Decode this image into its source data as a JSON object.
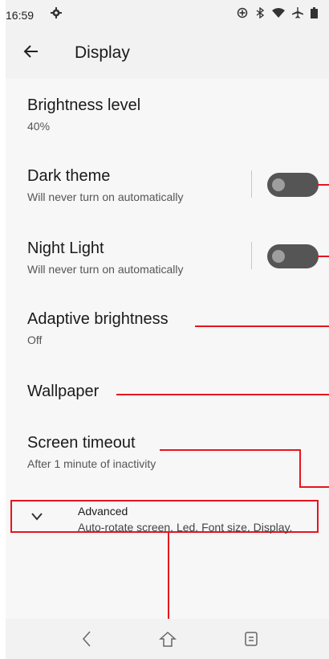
{
  "status_bar": {
    "time": "16:59",
    "icons": [
      "settings-gear-icon",
      "data-saver-icon",
      "bluetooth-icon",
      "wifi-icon",
      "airplane-mode-icon",
      "battery-icon"
    ]
  },
  "app_bar": {
    "title": "Display",
    "back_icon": "back-arrow-icon"
  },
  "settings": [
    {
      "title": "Brightness level",
      "subtitle": "40%"
    },
    {
      "title": "Dark theme",
      "subtitle": "Will never turn on automatically",
      "toggle": false
    },
    {
      "title": "Night Light",
      "subtitle": "Will never turn on automatically",
      "toggle": false
    },
    {
      "title": "Adaptive brightness",
      "subtitle": "Off"
    },
    {
      "title": "Wallpaper"
    },
    {
      "title": "Screen timeout",
      "subtitle": "After 1 minute of inactivity"
    }
  ],
  "advanced": {
    "title": "Advanced",
    "subtitle": "Auto-rotate screen, Led, Font size, Display."
  },
  "nav_bar": {
    "icons": [
      "nav-back-icon",
      "nav-home-icon",
      "nav-recents-icon"
    ]
  },
  "colors": {
    "annotation_red": "#e8141e",
    "toggle_off_track": "#555555",
    "background": "#f2f2f2"
  }
}
